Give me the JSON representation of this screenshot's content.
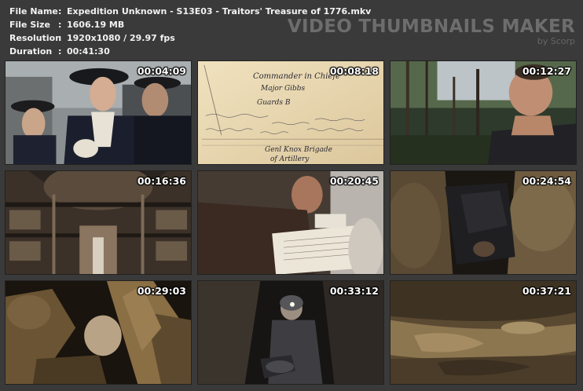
{
  "file_info": [
    {
      "label": "File Name",
      "value": "Expedition Unknown - S13E03 - Traitors' Treasure of 1776.mkv"
    },
    {
      "label": "File Size",
      "value": "1606.19 MB"
    },
    {
      "label": "Resolution",
      "value": "1920x1080 / 29.97 fps"
    },
    {
      "label": "Duration",
      "value": "00:41:30"
    }
  ],
  "separator": ":",
  "brand": {
    "title": "VIDEO THUMBNAILS MAKER",
    "subtitle": "by Scorp"
  },
  "thumbnails": [
    {
      "timestamp": "00:04:09",
      "scene": "colonial-men-portrait"
    },
    {
      "timestamp": "00:08:18",
      "scene": "handwritten-document"
    },
    {
      "timestamp": "00:12:27",
      "scene": "man-in-forest"
    },
    {
      "timestamp": "00:16:36",
      "scene": "grand-library-interior"
    },
    {
      "timestamp": "00:20:45",
      "scene": "man-reading-document"
    },
    {
      "timestamp": "00:24:54",
      "scene": "cave-crawling"
    },
    {
      "timestamp": "00:29:03",
      "scene": "rock-formation-closeup"
    },
    {
      "timestamp": "00:33:12",
      "scene": "caver-with-headlamp"
    },
    {
      "timestamp": "00:37:21",
      "scene": "cave-water-passage"
    }
  ],
  "document_text": {
    "line1": "Commander in Chiefe",
    "line2": "Major Gibbs",
    "line3": "Guards B",
    "line4": "Genl Knox Brigade",
    "line5": "of Artillery"
  }
}
